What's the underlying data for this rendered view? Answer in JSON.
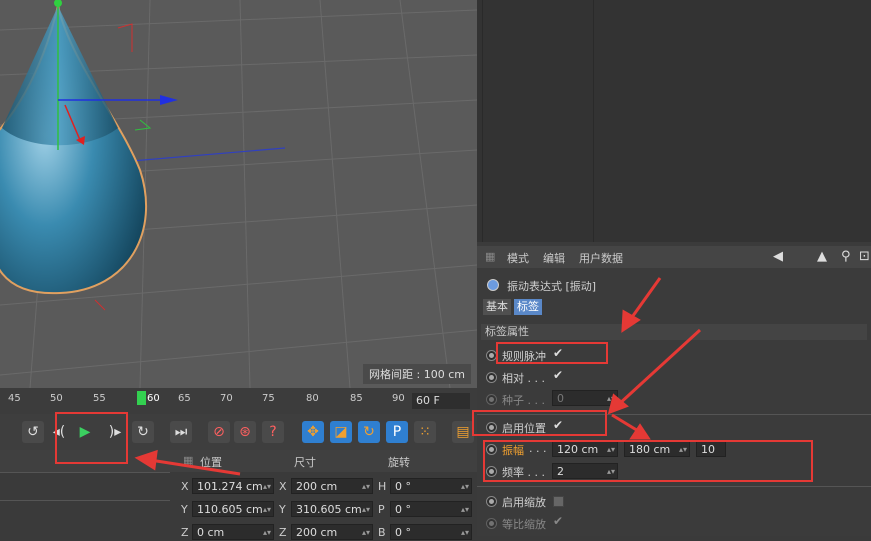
{
  "viewport": {
    "grid_spacing": "网格间距 : 100 cm"
  },
  "timeline": {
    "ticks": [
      "45",
      "50",
      "55",
      "60",
      "65",
      "70",
      "75",
      "80",
      "85",
      "90"
    ],
    "current_frame": "60",
    "frame_field": "60 F"
  },
  "transport": {
    "buttons": [
      "go-start",
      "step-back",
      "play",
      "step-forward",
      "go-end",
      "jump-end",
      "record-keys",
      "auto-key",
      "keyframe-help",
      "move",
      "scale",
      "rotate",
      "param",
      "points",
      "film"
    ]
  },
  "coords": {
    "headers": {
      "position": "位置",
      "size": "尺寸",
      "rotation": "旋转"
    },
    "rows": [
      {
        "axis": "X",
        "pos": "101.274 cm",
        "size_axis": "X",
        "size": "200 cm",
        "rot_axis": "H",
        "rot": "0 °"
      },
      {
        "axis": "Y",
        "pos": "110.605 cm",
        "size_axis": "Y",
        "size": "310.605 cm",
        "rot_axis": "P",
        "rot": "0 °"
      },
      {
        "axis": "Z",
        "pos": "0 cm",
        "size_axis": "Z",
        "size": "200 cm",
        "rot_axis": "B",
        "rot": "0 °"
      }
    ]
  },
  "attr": {
    "menu": [
      "模式",
      "编辑",
      "用户数据"
    ],
    "object_title": "振动表达式 [振动]",
    "tabs": [
      "基本",
      "标签"
    ],
    "section": "标签属性",
    "regular_pulse": "规则脉冲",
    "relative": "相对 . . .",
    "seed": "种子 . . .",
    "seed_value": "0",
    "enable_position": "启用位置",
    "amplitude": "振幅",
    "amplitude_dots": ". . .",
    "amp_x": "120 cm",
    "amp_y": "180 cm",
    "amp_z": "10",
    "frequency": "频率 . . .",
    "freq_value": "2",
    "enable_scale": "启用缩放",
    "uniform_scale": "等比缩放"
  },
  "colors": {
    "annotation": "#e53935",
    "cone": "#2c6f8c",
    "accent_orange": "#f0a030"
  }
}
